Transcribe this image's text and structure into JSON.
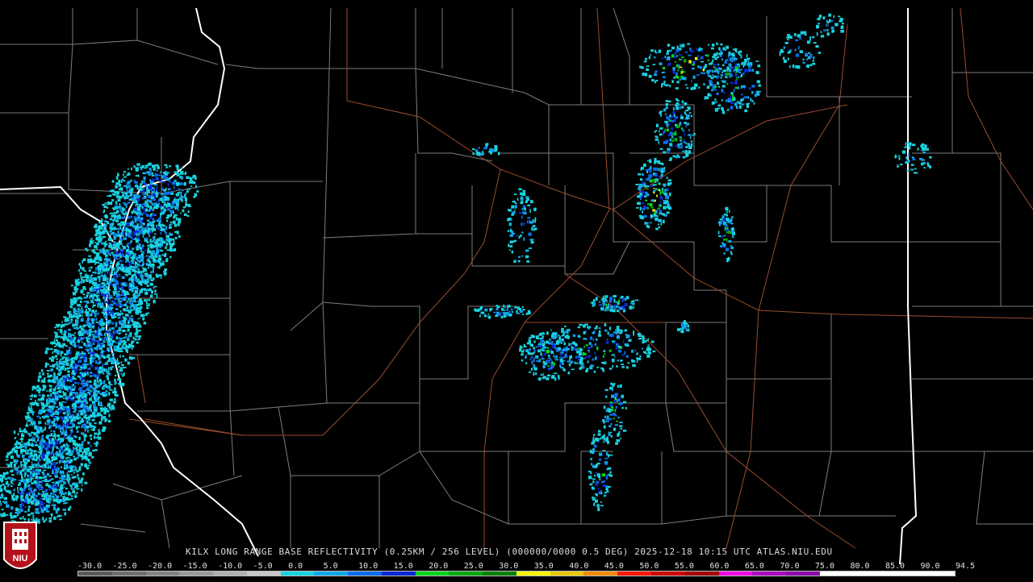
{
  "caption": "KILX LONG RANGE BASE REFLECTIVITY (0.25KM / 256 LEVEL) (000000/0000 0.5 DEG) 2025-12-18 10:15 UTC  ATLAS.NIU.EDU",
  "logo": {
    "label": "NIU",
    "colors": {
      "bg": "#b4121b",
      "text": "#ffffff"
    }
  },
  "colorbar": {
    "tick_labels": [
      "-30.0",
      "-25.0",
      "-20.0",
      "-15.0",
      "-10.0",
      "-5.0",
      "0.0",
      "5.0",
      "10.0",
      "15.0",
      "20.0",
      "25.0",
      "30.0",
      "35.0",
      "40.0",
      "45.0",
      "50.0",
      "55.0",
      "60.0",
      "65.0",
      "70.0",
      "75.0",
      "80.0",
      "85.0",
      "90.0",
      "94.5"
    ],
    "colors": [
      "#5a5a5a",
      "#6e6e6e",
      "#838383",
      "#9a9a9a",
      "#b0b0b0",
      "#c7c7c7",
      "#19d3e0",
      "#12a8e6",
      "#0c6ee8",
      "#0a2ad4",
      "#0ad41f",
      "#06a812",
      "#058008",
      "#f5f20c",
      "#e8c60a",
      "#f08a0a",
      "#f51a0a",
      "#cc0a0a",
      "#a0060a",
      "#f00ae6",
      "#b00ac0",
      "#8a0aa8",
      "#ffffff",
      "#ffffff",
      "#ffffff",
      "#ffffff"
    ]
  },
  "map_colors": {
    "county": "#7d7d7d",
    "state": "#ffffff",
    "road": "#9a4d2e"
  }
}
